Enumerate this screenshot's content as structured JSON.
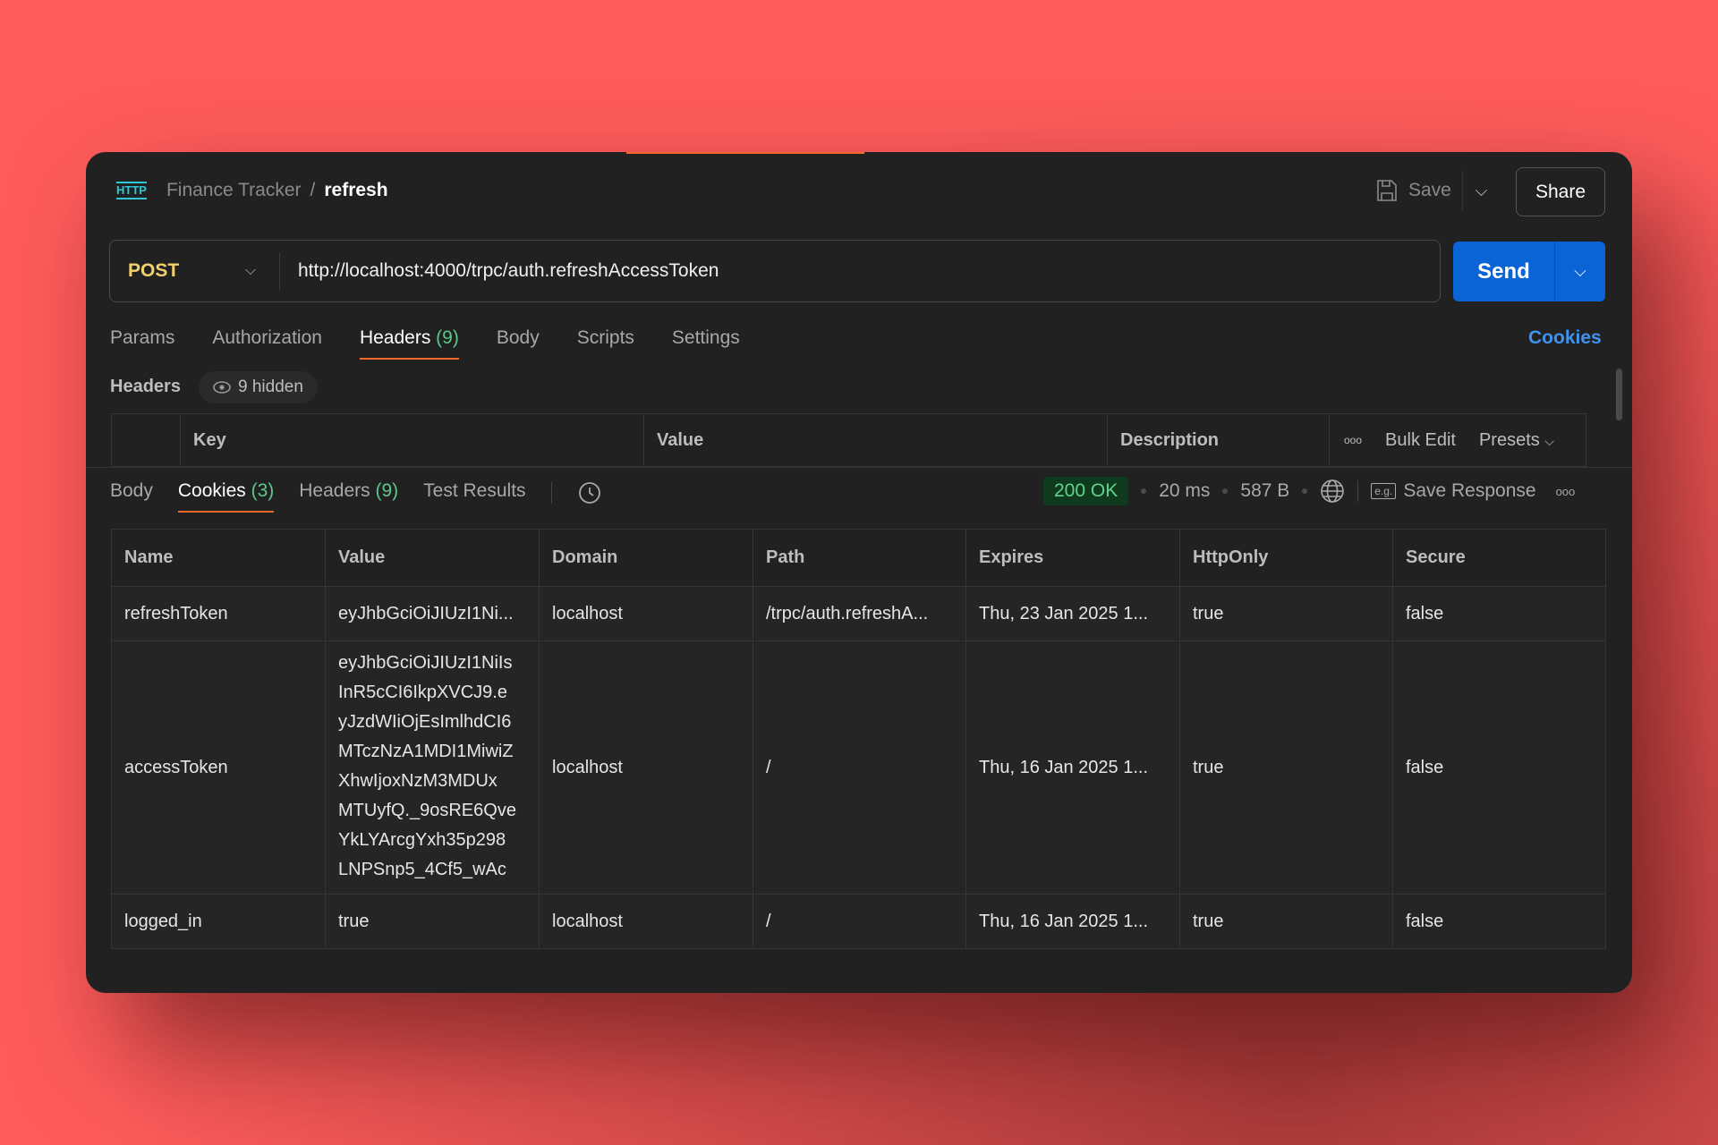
{
  "breadcrumb": {
    "collection": "Finance Tracker",
    "separator": "/",
    "request": "refresh",
    "icon": "HTTP"
  },
  "toolbar": {
    "save_label": "Save",
    "share_label": "Share"
  },
  "request": {
    "method": "POST",
    "url": "http://localhost:4000/trpc/auth.refreshAccessToken",
    "send_label": "Send"
  },
  "request_tabs": [
    {
      "label": "Params"
    },
    {
      "label": "Authorization"
    },
    {
      "label": "Headers",
      "count": "(9)"
    },
    {
      "label": "Body"
    },
    {
      "label": "Scripts"
    },
    {
      "label": "Settings"
    }
  ],
  "cookies_link": "Cookies",
  "headers_section": {
    "label": "Headers",
    "hidden": "9 hidden",
    "columns": [
      "Key",
      "Value",
      "Description"
    ],
    "bulk_edit": "Bulk Edit",
    "presets": "Presets"
  },
  "response_tabs": [
    {
      "label": "Body"
    },
    {
      "label": "Cookies",
      "count": "(3)"
    },
    {
      "label": "Headers",
      "count": "(9)"
    },
    {
      "label": "Test Results"
    }
  ],
  "response_meta": {
    "status": "200 OK",
    "time": "20 ms",
    "size": "587 B",
    "save_response": "Save Response",
    "status_color": "#5fd38d"
  },
  "cookies_table": {
    "columns": [
      "Name",
      "Value",
      "Domain",
      "Path",
      "Expires",
      "HttpOnly",
      "Secure"
    ],
    "rows": [
      {
        "name": "refreshToken",
        "value": "eyJhbGciOiJIUzI1Ni...",
        "domain": "localhost",
        "path": "/trpc/auth.refreshA...",
        "expires": "Thu, 23 Jan 2025 1...",
        "httponly": "true",
        "secure": "false"
      },
      {
        "name": "accessToken",
        "value_lines": [
          "eyJhbGciOiJIUzI1NiIs",
          "InR5cCI6IkpXVCJ9.e",
          "yJzdWIiOjEsImlhdCI6",
          "MTczNzA1MDI1MiwiZ",
          "XhwIjoxNzM3MDUx",
          "MTUyfQ._9osRE6Qve",
          "YkLYArcgYxh35p298",
          "LNPSnp5_4Cf5_wAc"
        ],
        "domain": "localhost",
        "path": "/",
        "expires": "Thu, 16 Jan 2025 1...",
        "httponly": "true",
        "secure": "false"
      },
      {
        "name": "logged_in",
        "value": "true",
        "domain": "localhost",
        "path": "/",
        "expires": "Thu, 16 Jan 2025 1...",
        "httponly": "true",
        "secure": "false"
      }
    ]
  },
  "colors": {
    "accent": "#f06a2a",
    "send": "#0b64d6",
    "method": "#f2d06b",
    "link": "#3d93f0",
    "count": "#5bc98a"
  }
}
